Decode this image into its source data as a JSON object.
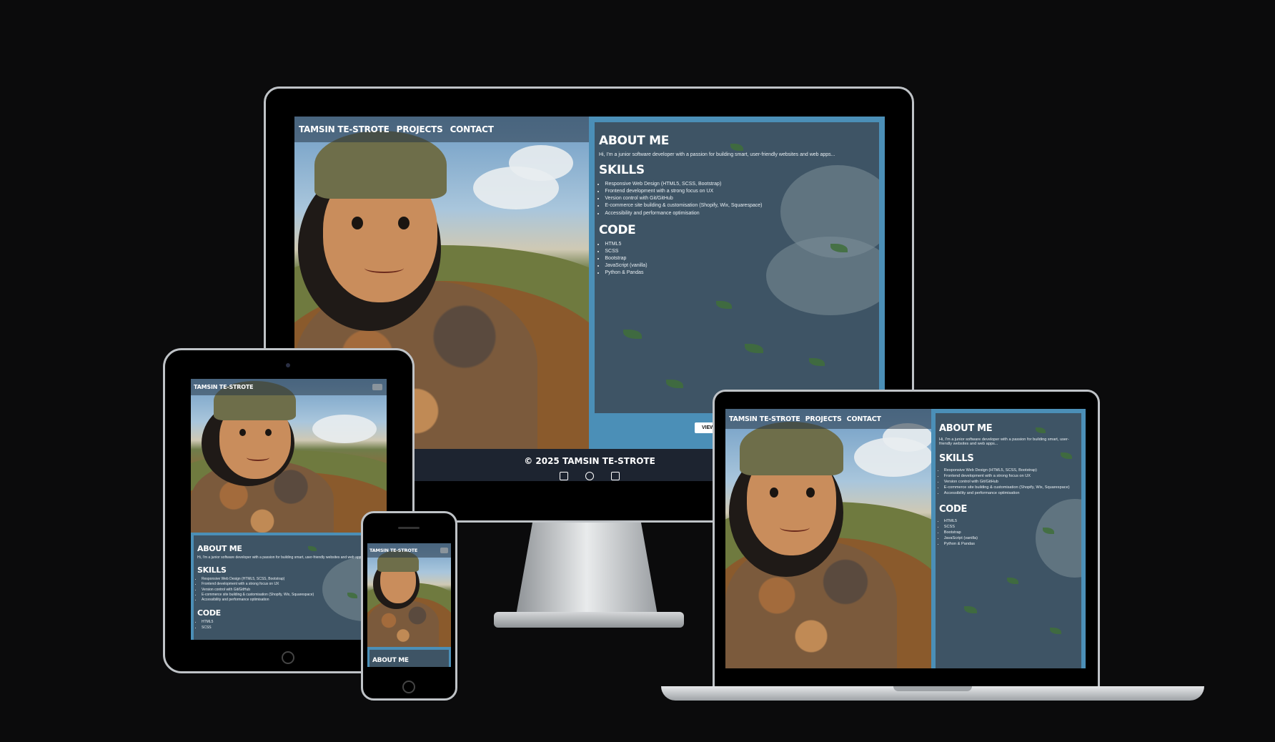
{
  "site": {
    "brand": "TAMSIN TE-STROTE",
    "nav": [
      "PROJECTS",
      "CONTACT"
    ],
    "about_heading": "ABOUT ME",
    "about_text": "Hi, I'm a junior software developer with a passion for building smart, user-friendly websites and web apps...",
    "skills_heading": "SKILLS",
    "skills": [
      "Responsive Web Design (HTML5, SCSS, Bootstrap)",
      "Frontend development with a strong focus on UX",
      "Version control with Git/GitHub",
      "E-commerce site building & customisation (Shopify, Wix, Squarespace)",
      "Accessibility and performance optimisation"
    ],
    "code_heading": "CODE",
    "code": [
      "HTML5",
      "SCSS",
      "Bootstrap",
      "JavaScript (vanilla)",
      "Python & Pandas"
    ],
    "view_button": "VIEW",
    "footer": "© 2025 TAMSIN TE-STROTE",
    "footer_icons": [
      "linkedin-icon",
      "github-icon",
      "email-icon"
    ]
  },
  "colors": {
    "background": "#0b0b0c",
    "panel": "#3e5465",
    "panel_border": "#4b8fb7",
    "footer": "#1d2430"
  }
}
